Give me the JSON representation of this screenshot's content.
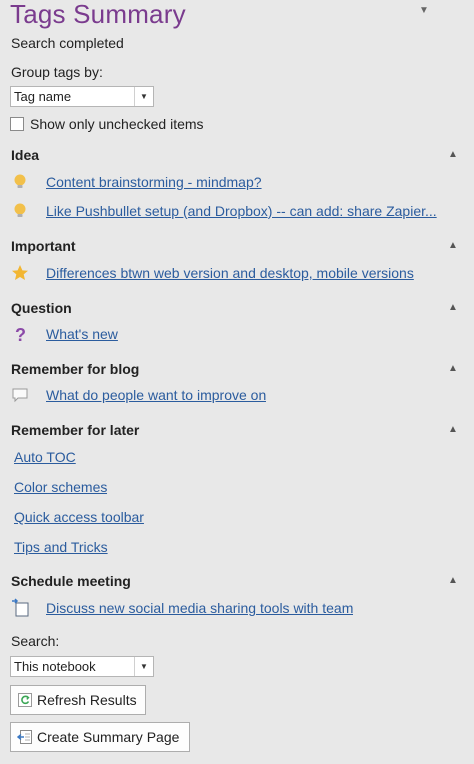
{
  "pane": {
    "title": "Tags Summary",
    "status": "Search completed"
  },
  "group_by": {
    "label": "Group tags by:",
    "selected": "Tag name"
  },
  "show_unchecked": {
    "label": "Show only unchecked items",
    "checked": false
  },
  "sections": [
    {
      "name": "Idea",
      "icon": "lightbulb-icon",
      "items": [
        "Content brainstorming - mindmap?",
        "Like Pushbullet setup (and Dropbox) -- can add: share Zapier..."
      ]
    },
    {
      "name": "Important",
      "icon": "star-icon",
      "items": [
        "Differences btwn web version and desktop, mobile versions"
      ]
    },
    {
      "name": "Question",
      "icon": "question-mark-icon",
      "items": [
        "What's new"
      ]
    },
    {
      "name": "Remember for blog",
      "icon": "speech-bubble-icon",
      "items": [
        "What do people want to improve on"
      ]
    },
    {
      "name": "Remember for later",
      "icon": "none",
      "items": [
        "Auto TOC",
        "Color schemes",
        "Quick access toolbar",
        "Tips and Tricks"
      ]
    },
    {
      "name": "Schedule meeting",
      "icon": "calendar-arrow-icon",
      "items": [
        "Discuss new social media sharing tools with team"
      ]
    }
  ],
  "search": {
    "label": "Search:",
    "selected": "This notebook"
  },
  "buttons": {
    "refresh": "Refresh Results",
    "create_summary": "Create Summary Page"
  },
  "colors": {
    "title": "#7a3b8e",
    "link": "#2b5c9e",
    "background": "#e8e8e8",
    "lightbulb": "#f2c04a",
    "star": "#f2b632",
    "question": "#8b4aa8"
  }
}
